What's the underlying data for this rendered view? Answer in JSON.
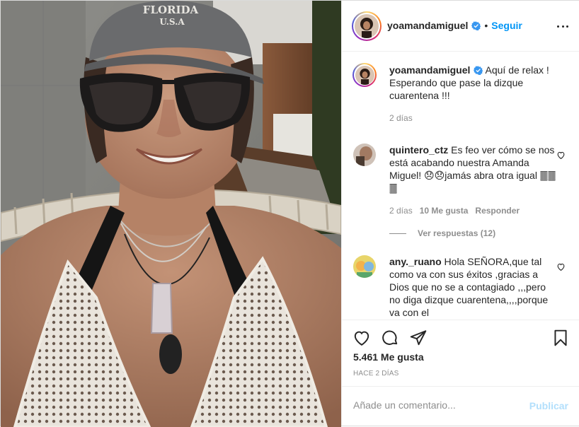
{
  "post": {
    "author": "yoamandamiguel",
    "follow_label": "Seguir",
    "separator": "•"
  },
  "caption": {
    "username": "yoamandamiguel",
    "text": "Aquí de relax ! Esperando que pase la dizque cuarentena !!!",
    "time": "2 días"
  },
  "comments": [
    {
      "username": "quintero_ctz",
      "text": "Es feo ver cómo se nos está acabando nuestra Amanda Miguel! 😞😞jamás abra otra igual 🀫🀫🀫",
      "time": "2 días",
      "likes": "10 Me gusta",
      "reply": "Responder",
      "view_replies": "Ver respuestas (12)"
    },
    {
      "username": "any._ruano",
      "text": "Hola SEÑORA,que tal como va con sus éxitos ,gracias a Dios que no se a contagiado ,,,pero no diga dizque cuarentena,,,,porque va con el"
    }
  ],
  "stats": {
    "likes": "5.461 Me gusta",
    "posted": "HACE 2 DÍAS"
  },
  "composer": {
    "placeholder": "Añade un comentario...",
    "publish_label": "Publicar"
  },
  "icons": [
    "verified-badge-icon",
    "more-options-icon",
    "heart-icon",
    "comment-icon",
    "share-icon",
    "bookmark-icon"
  ],
  "colors": {
    "accent": "#0095f6",
    "publish_disabled": "#b2dffc",
    "muted_text": "#8e8e8e",
    "text": "#262626",
    "border": "#efefef"
  },
  "image": {
    "cap_text": "FLORIDA U.S.A"
  }
}
